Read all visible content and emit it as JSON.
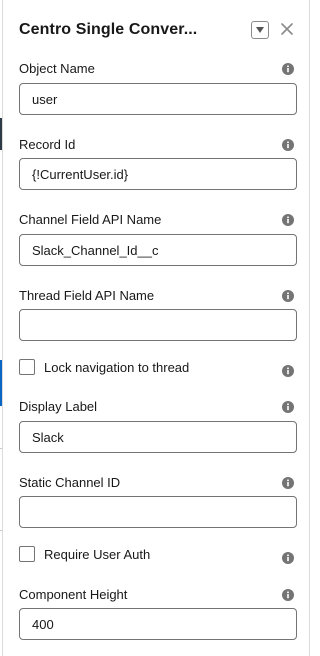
{
  "panel": {
    "title": "Centro Single Conver...",
    "dropdown_icon": "chevron-down-icon",
    "close_icon": "close-icon"
  },
  "fields": {
    "object_name": {
      "label": "Object Name",
      "value": "user"
    },
    "record_id": {
      "label": "Record Id",
      "value": "{!CurrentUser.id}"
    },
    "channel_field": {
      "label": "Channel Field API Name",
      "value": "Slack_Channel_Id__c"
    },
    "thread_field": {
      "label": "Thread Field API Name",
      "value": ""
    },
    "lock_navigation": {
      "label": "Lock navigation to thread",
      "checked": false
    },
    "display_label": {
      "label": "Display Label",
      "value": "Slack"
    },
    "static_channel": {
      "label": "Static Channel ID",
      "value": ""
    },
    "require_auth": {
      "label": "Require User Auth",
      "checked": false
    },
    "component_height": {
      "label": "Component Height",
      "value": "400"
    }
  },
  "colors": {
    "border": "#747474",
    "info_icon": "#747474",
    "close_icon": "#8a8a8a"
  }
}
